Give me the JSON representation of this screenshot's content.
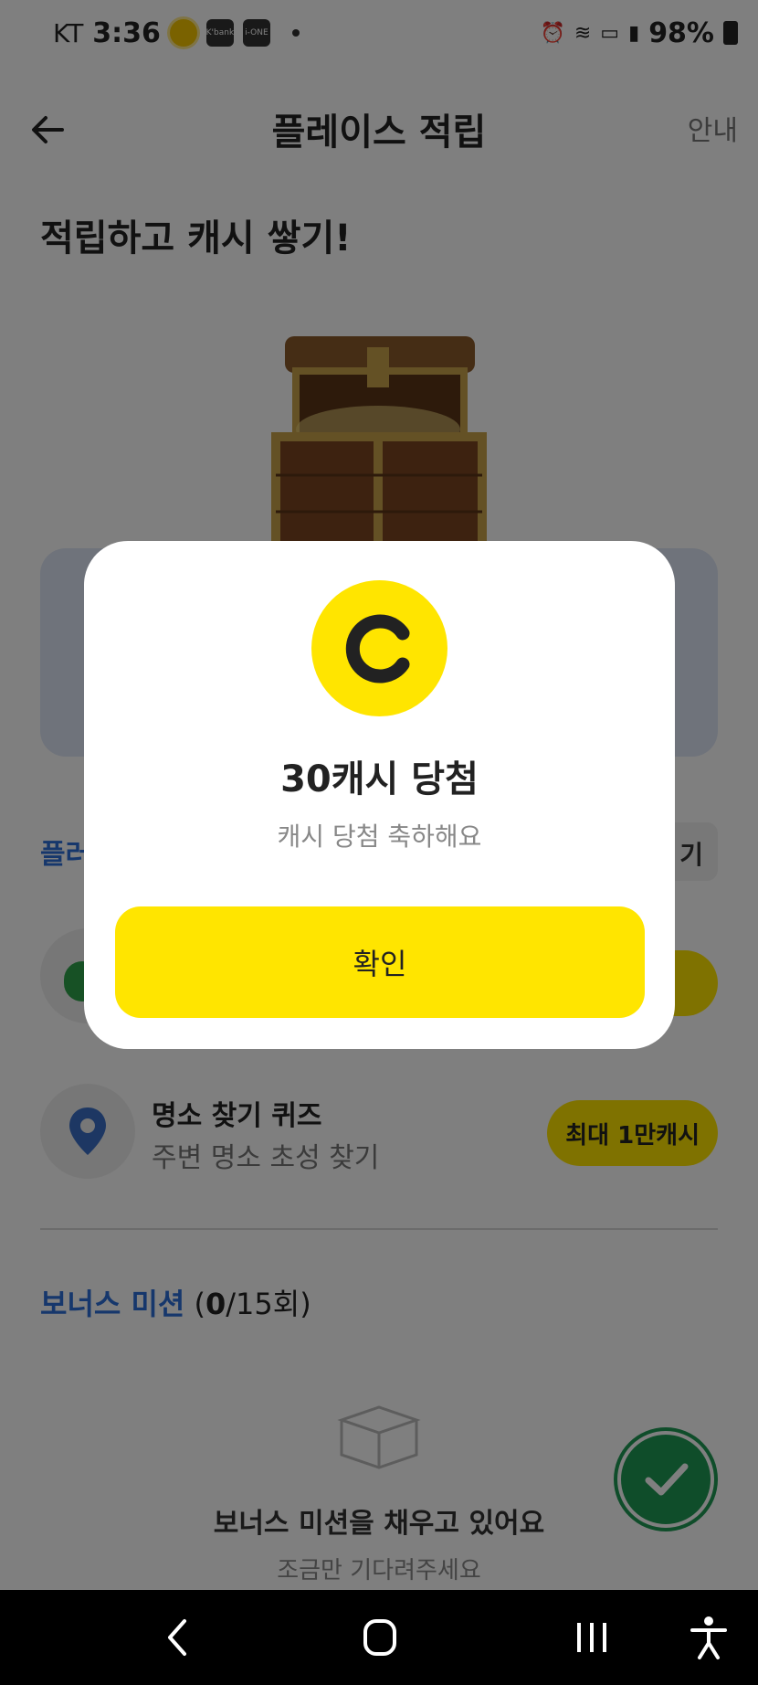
{
  "status_bar": {
    "carrier": "KT",
    "time": "3:36",
    "app_icon_1": "K'bank",
    "app_icon_2": "i-ONE",
    "battery": "98%"
  },
  "header": {
    "title": "플레이스 적립",
    "info": "안내"
  },
  "hero": {
    "title": "적립하고 캐시 쌓기!"
  },
  "background_partial": {
    "section_label": "플러",
    "right_chip": "기"
  },
  "missions": [
    {
      "title": "명소 찾기 퀴즈",
      "subtitle": "주변 명소 초성 찾기",
      "reward": "최대 1만캐시"
    }
  ],
  "bonus": {
    "title": "보너스 미션",
    "open": " (",
    "current": "0",
    "rest": "/15회)"
  },
  "empty_state": {
    "title": "보너스 미션을 채우고 있어요",
    "subtitle": "조금만 기다려주세요"
  },
  "dialog": {
    "title": "30캐시 당첨",
    "subtitle": "캐시 당첨 축하해요",
    "confirm_label": "확인"
  },
  "colors": {
    "accent_yellow": "#ffe500",
    "link_blue": "#2c6fd9",
    "success_green": "#1e9a55"
  },
  "icons": {
    "back": "arrow-left-icon",
    "coin": "cash-c-icon",
    "location": "location-pin-icon",
    "empty": "empty-box-icon",
    "fab": "check-icon"
  }
}
